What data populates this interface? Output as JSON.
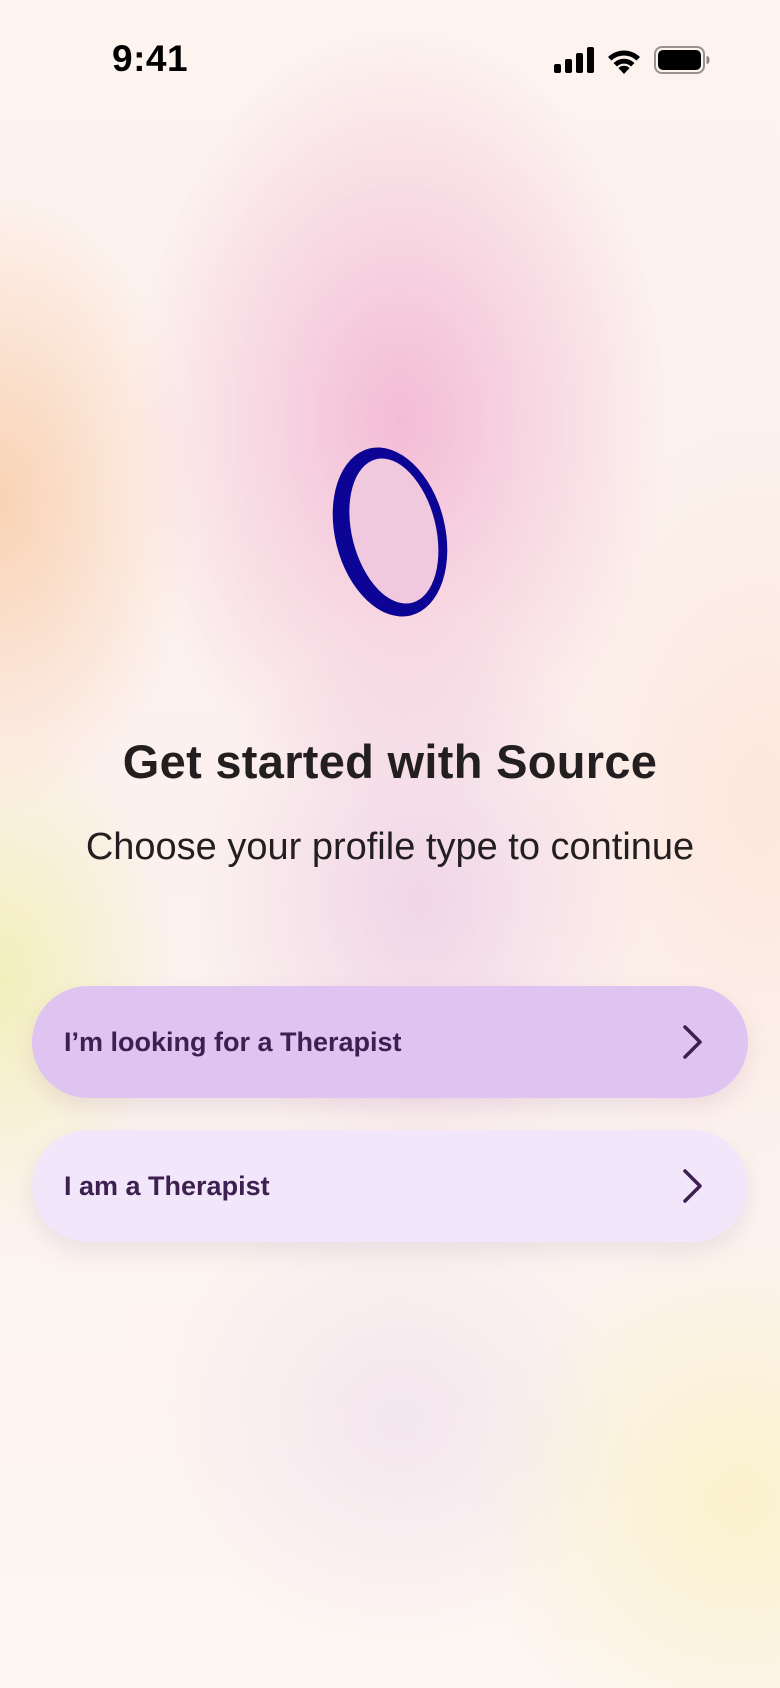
{
  "status_bar": {
    "time": "9:41",
    "icons": [
      "cellular-signal-icon",
      "wifi-icon",
      "battery-icon"
    ]
  },
  "logo": {
    "icon": "source-logo-icon",
    "color": "#0b0495"
  },
  "main": {
    "title": "Get started with Source",
    "subtitle": "Choose your profile type to continue",
    "options": [
      {
        "label": "I’m looking for a Therapist",
        "icon": "chevron-right-icon",
        "color": "#dfc4f2"
      },
      {
        "label": "I am a Therapist",
        "icon": "chevron-right-icon",
        "color": "#f2e6fb"
      }
    ]
  },
  "colors": {
    "text": "#231f20",
    "button_text": "#3d2050",
    "brand": "#0b0495"
  }
}
